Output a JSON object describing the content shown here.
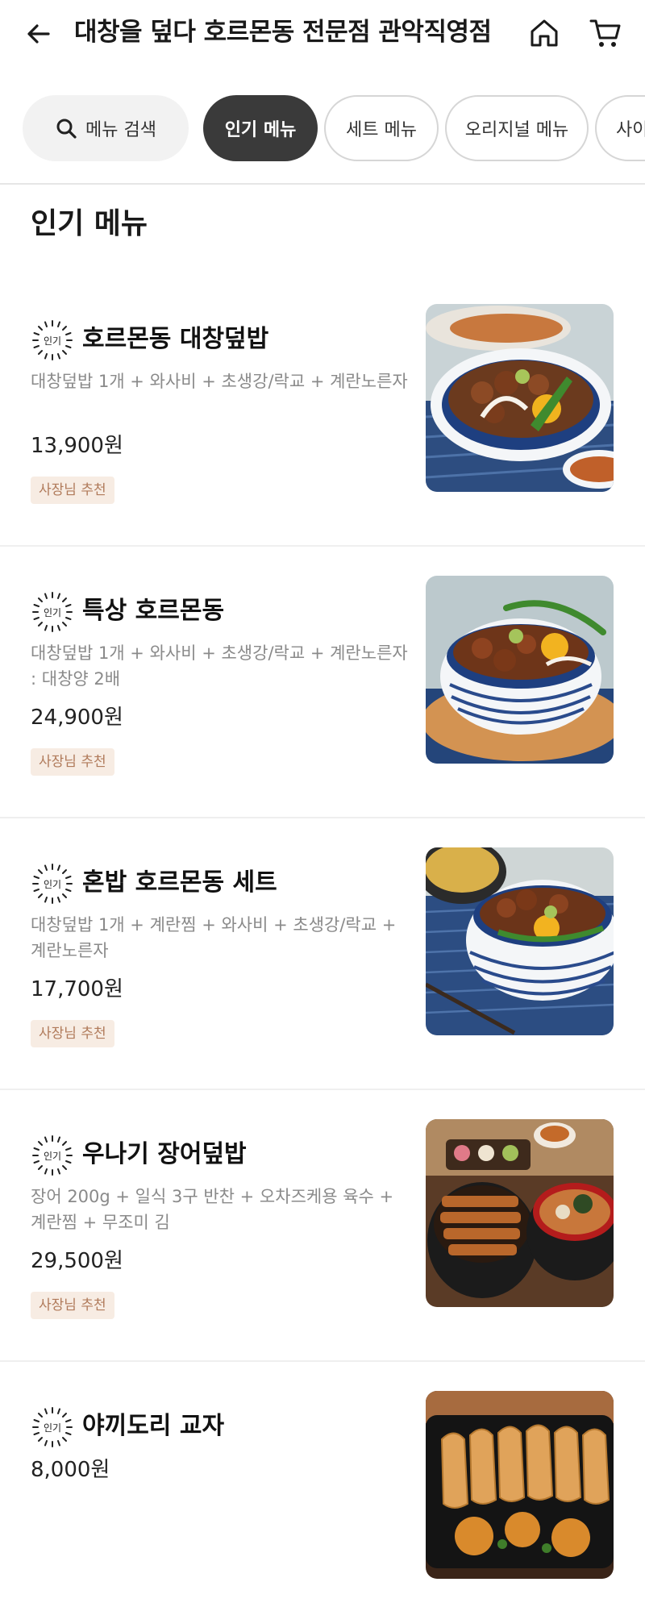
{
  "header": {
    "title": "대창을 덮다 호르몬동 전문점 관악직영점"
  },
  "chips": {
    "search": "메뉴 검색",
    "popular": "인기 메뉴",
    "set": "세트 메뉴",
    "original": "오리지널 메뉴",
    "side": "사이"
  },
  "section": {
    "title": "인기 메뉴"
  },
  "items": [
    {
      "badge": "인기",
      "name": "호르몬동 대창덮밥",
      "desc": "대창덮밥 1개 + 와사비 + 초생강/락교 + 계란노른자",
      "price": "13,900원",
      "tag": "사장님 추천"
    },
    {
      "badge": "인기",
      "name": "특상 호르몬동",
      "desc": "대창덮밥 1개 + 와사비 + 초생강/락교 + 계란노른자 : 대창양 2배",
      "price": "24,900원",
      "tag": "사장님 추천"
    },
    {
      "badge": "인기",
      "name": "혼밥 호르몬동 세트",
      "desc": "대창덮밥 1개 + 계란찜 + 와사비 + 초생강/락교 + 계란노른자",
      "price": "17,700원",
      "tag": "사장님 추천"
    },
    {
      "badge": "인기",
      "name": "우나기 장어덮밥",
      "desc": "장어 200g + 일식 3구 반찬 + 오차즈케용 육수 + 계란찜 + 무조미 김",
      "price": "29,500원",
      "tag": "사장님 추천"
    },
    {
      "badge": "인기",
      "name": "야끼도리 교자",
      "desc": "",
      "price": "8,000원",
      "tag": ""
    }
  ],
  "icons": {
    "back": "arrow-left-icon",
    "home": "home-icon",
    "cart": "cart-icon",
    "search": "search-icon"
  },
  "colors": {
    "active_chip": "#3a3a3a",
    "owner_badge_bg": "#f7ece3",
    "owner_badge_text": "#b07a5a"
  }
}
